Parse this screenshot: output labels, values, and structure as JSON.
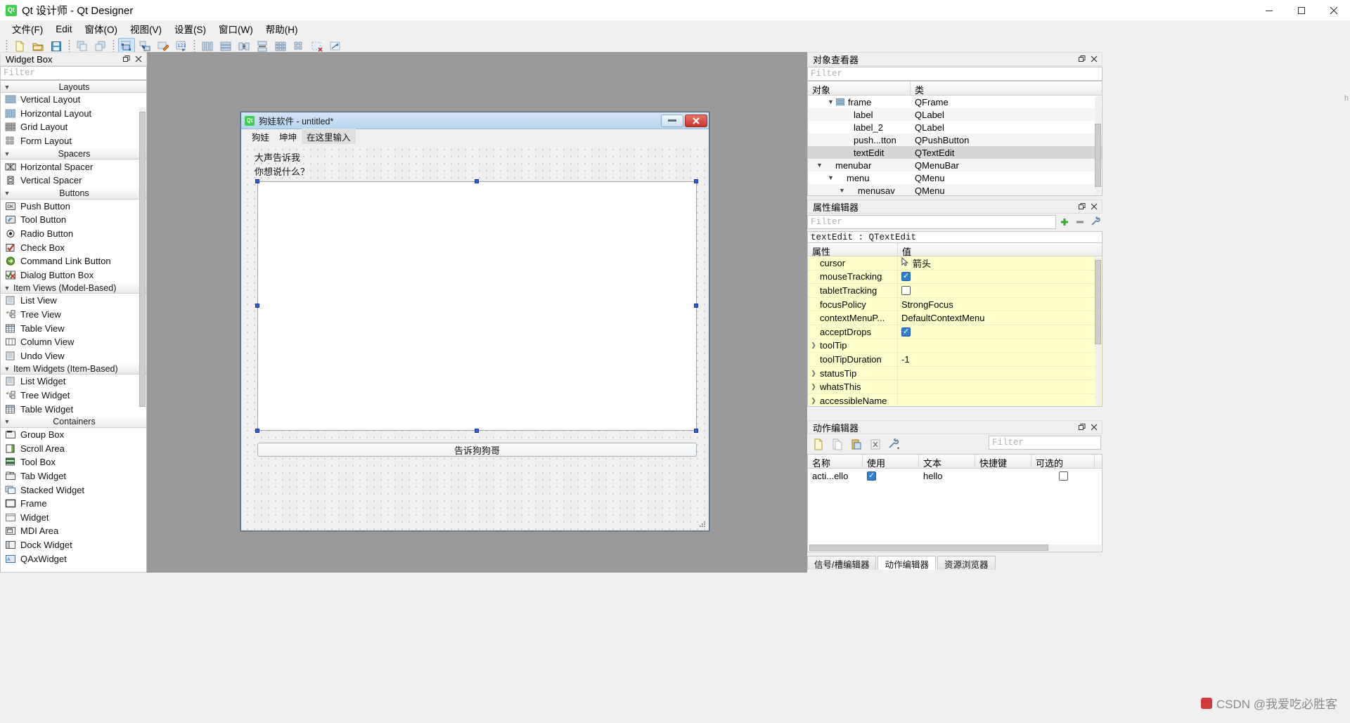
{
  "window": {
    "title": "Qt 设计师 - Qt Designer",
    "logo_text": "Qt",
    "minimize": "—",
    "maximize": "❐",
    "close": "✕"
  },
  "menubar": {
    "items": [
      {
        "label": "文件(F)"
      },
      {
        "label": "Edit"
      },
      {
        "label": "窗体(O)"
      },
      {
        "label": "视图(V)"
      },
      {
        "label": "设置(S)"
      },
      {
        "label": "窗口(W)"
      },
      {
        "label": "帮助(H)"
      }
    ]
  },
  "toolbar": {
    "buttons": [
      {
        "name": "new-form-icon",
        "title": "新建"
      },
      {
        "name": "open-form-icon",
        "title": "打开"
      },
      {
        "name": "save-form-icon",
        "title": "保存"
      },
      {
        "name": "undo-icon",
        "title": "撤销"
      },
      {
        "name": "redo-icon",
        "title": "重做"
      },
      {
        "name": "edit-widgets-icon",
        "title": "编辑窗口部件",
        "active": true
      },
      {
        "name": "edit-signals-slots-icon",
        "title": "编辑信号/槽"
      },
      {
        "name": "edit-buddies-icon",
        "title": "编辑伙伴"
      },
      {
        "name": "edit-tab-order-icon",
        "title": "编辑 Tab 顺序"
      },
      {
        "name": "layout-horizontally-icon",
        "title": "水平布局"
      },
      {
        "name": "layout-vertically-icon",
        "title": "垂直布局"
      },
      {
        "name": "layout-splitter-h-icon",
        "title": "水平分裂器布局"
      },
      {
        "name": "layout-splitter-v-icon",
        "title": "垂直分裂器布局"
      },
      {
        "name": "layout-grid-icon",
        "title": "栅格布局"
      },
      {
        "name": "layout-form-icon",
        "title": "表单布局"
      },
      {
        "name": "break-layout-icon",
        "title": "打破布局"
      },
      {
        "name": "adjust-size-icon",
        "title": "调整大小"
      }
    ]
  },
  "widget_box": {
    "title": "Widget Box",
    "filter_placeholder": "Filter",
    "groups": [
      {
        "name": "Layouts",
        "items": [
          {
            "label": "Vertical Layout",
            "icon": "vertical-layout-icon"
          },
          {
            "label": "Horizontal Layout",
            "icon": "horizontal-layout-icon"
          },
          {
            "label": "Grid Layout",
            "icon": "grid-layout-icon"
          },
          {
            "label": "Form Layout",
            "icon": "form-layout-icon"
          }
        ]
      },
      {
        "name": "Spacers",
        "items": [
          {
            "label": "Horizontal Spacer",
            "icon": "horizontal-spacer-icon"
          },
          {
            "label": "Vertical Spacer",
            "icon": "vertical-spacer-icon"
          }
        ]
      },
      {
        "name": "Buttons",
        "items": [
          {
            "label": "Push Button",
            "icon": "push-button-icon"
          },
          {
            "label": "Tool Button",
            "icon": "tool-button-icon"
          },
          {
            "label": "Radio Button",
            "icon": "radio-button-icon"
          },
          {
            "label": "Check Box",
            "icon": "check-box-icon"
          },
          {
            "label": "Command Link Button",
            "icon": "command-link-button-icon"
          },
          {
            "label": "Dialog Button Box",
            "icon": "dialog-button-box-icon"
          }
        ]
      },
      {
        "name": "Item Views (Model-Based)",
        "align": "left",
        "items": [
          {
            "label": "List View",
            "icon": "list-view-icon"
          },
          {
            "label": "Tree View",
            "icon": "tree-view-icon"
          },
          {
            "label": "Table View",
            "icon": "table-view-icon"
          },
          {
            "label": "Column View",
            "icon": "column-view-icon"
          },
          {
            "label": "Undo View",
            "icon": "undo-view-icon"
          }
        ]
      },
      {
        "name": "Item Widgets (Item-Based)",
        "align": "left",
        "items": [
          {
            "label": "List Widget",
            "icon": "list-widget-icon"
          },
          {
            "label": "Tree Widget",
            "icon": "tree-widget-icon"
          },
          {
            "label": "Table Widget",
            "icon": "table-widget-icon"
          }
        ]
      },
      {
        "name": "Containers",
        "items": [
          {
            "label": "Group Box",
            "icon": "group-box-icon"
          },
          {
            "label": "Scroll Area",
            "icon": "scroll-area-icon"
          },
          {
            "label": "Tool Box",
            "icon": "tool-box-icon"
          },
          {
            "label": "Tab Widget",
            "icon": "tab-widget-icon"
          },
          {
            "label": "Stacked Widget",
            "icon": "stacked-widget-icon"
          },
          {
            "label": "Frame",
            "icon": "frame-icon"
          },
          {
            "label": "Widget",
            "icon": "widget-icon"
          },
          {
            "label": "MDI Area",
            "icon": "mdi-area-icon"
          },
          {
            "label": "Dock Widget",
            "icon": "dock-widget-icon"
          },
          {
            "label": "QAxWidget",
            "icon": "qax-widget-icon"
          }
        ]
      }
    ]
  },
  "form": {
    "title": "狗娃软件 - untitled*",
    "logo_text": "Qt",
    "minimize": "—",
    "close": "✕",
    "menus": [
      {
        "label": "狗娃",
        "selected": false
      },
      {
        "label": "坤坤",
        "selected": false
      },
      {
        "label": "在这里输入",
        "selected": true
      }
    ],
    "label_1": "大声告诉我",
    "label_2": "你想说什么？",
    "button_label": "告诉狗狗哥"
  },
  "object_inspector": {
    "title": "对象查看器",
    "filter_placeholder": "Filter",
    "columns": [
      "对象",
      "类"
    ],
    "rows": [
      {
        "name": "frame",
        "class": "QFrame",
        "indent": 1,
        "expandable": true,
        "expanded": true,
        "icon": "frame-icon",
        "selected": false,
        "alt": false
      },
      {
        "name": "label",
        "class": "QLabel",
        "indent": 2,
        "expandable": false,
        "selected": false,
        "alt": true
      },
      {
        "name": "label_2",
        "class": "QLabel",
        "indent": 2,
        "expandable": false,
        "selected": false,
        "alt": false
      },
      {
        "name": "push...tton",
        "class": "QPushButton",
        "indent": 2,
        "expandable": false,
        "selected": false,
        "alt": true
      },
      {
        "name": "textEdit",
        "class": "QTextEdit",
        "indent": 2,
        "expandable": false,
        "selected": true,
        "alt": false
      },
      {
        "name": "menubar",
        "class": "QMenuBar",
        "indent": 0,
        "expandable": true,
        "expanded": true,
        "selected": false,
        "alt": true
      },
      {
        "name": "menu",
        "class": "QMenu",
        "indent": 1,
        "expandable": true,
        "expanded": true,
        "selected": false,
        "alt": false
      },
      {
        "name": "menusav",
        "class": "QMenu",
        "indent": 2,
        "expandable": true,
        "expanded": true,
        "selected": false,
        "alt": true
      }
    ]
  },
  "property_editor": {
    "title": "属性编辑器",
    "filter_placeholder": "Filter",
    "object_header": "textEdit : QTextEdit",
    "columns": [
      "属性",
      "值"
    ],
    "toolbuttons": [
      {
        "name": "add-dynamic-property-icon",
        "glyph": "+"
      },
      {
        "name": "remove-dynamic-property-icon",
        "glyph": "−"
      },
      {
        "name": "configure-property-editor-icon",
        "glyph": "wrench"
      }
    ],
    "rows": [
      {
        "prop": "cursor",
        "value": "箭头",
        "type": "cursor",
        "expandable": false
      },
      {
        "prop": "mouseTracking",
        "value": "",
        "type": "checkbox",
        "checked": true,
        "expandable": false
      },
      {
        "prop": "tabletTracking",
        "value": "",
        "type": "checkbox",
        "checked": false,
        "expandable": false
      },
      {
        "prop": "focusPolicy",
        "value": "StrongFocus",
        "type": "text",
        "expandable": false
      },
      {
        "prop": "contextMenuP...",
        "value": "DefaultContextMenu",
        "type": "text",
        "expandable": false
      },
      {
        "prop": "acceptDrops",
        "value": "",
        "type": "checkbox",
        "checked": true,
        "expandable": false
      },
      {
        "prop": "toolTip",
        "value": "",
        "type": "text",
        "expandable": true
      },
      {
        "prop": "toolTipDuration",
        "value": "-1",
        "type": "text",
        "expandable": false
      },
      {
        "prop": "statusTip",
        "value": "",
        "type": "text",
        "expandable": true
      },
      {
        "prop": "whatsThis",
        "value": "",
        "type": "text",
        "expandable": true
      },
      {
        "prop": "accessibleName",
        "value": "",
        "type": "text",
        "expandable": true
      }
    ]
  },
  "action_editor": {
    "title": "动作编辑器",
    "filter_placeholder": "Filter",
    "toolbuttons": [
      {
        "name": "new-action-icon"
      },
      {
        "name": "copy-action-icon"
      },
      {
        "name": "paste-action-icon"
      },
      {
        "name": "delete-action-icon"
      },
      {
        "name": "configure-action-editor-icon"
      }
    ],
    "columns": [
      "名称",
      "使用",
      "文本",
      "快捷键",
      "可选的"
    ],
    "rows": [
      {
        "name": "acti...ello",
        "used": true,
        "text": "hello",
        "shortcut": "",
        "checkable": false
      }
    ],
    "tabs": [
      {
        "label": "信号/槽编辑器",
        "selected": false
      },
      {
        "label": "动作编辑器",
        "selected": true
      },
      {
        "label": "资源浏览器",
        "selected": false
      }
    ]
  },
  "watermark": {
    "text": "CSDN @我爱吃必胜客",
    "side_text": "h"
  }
}
